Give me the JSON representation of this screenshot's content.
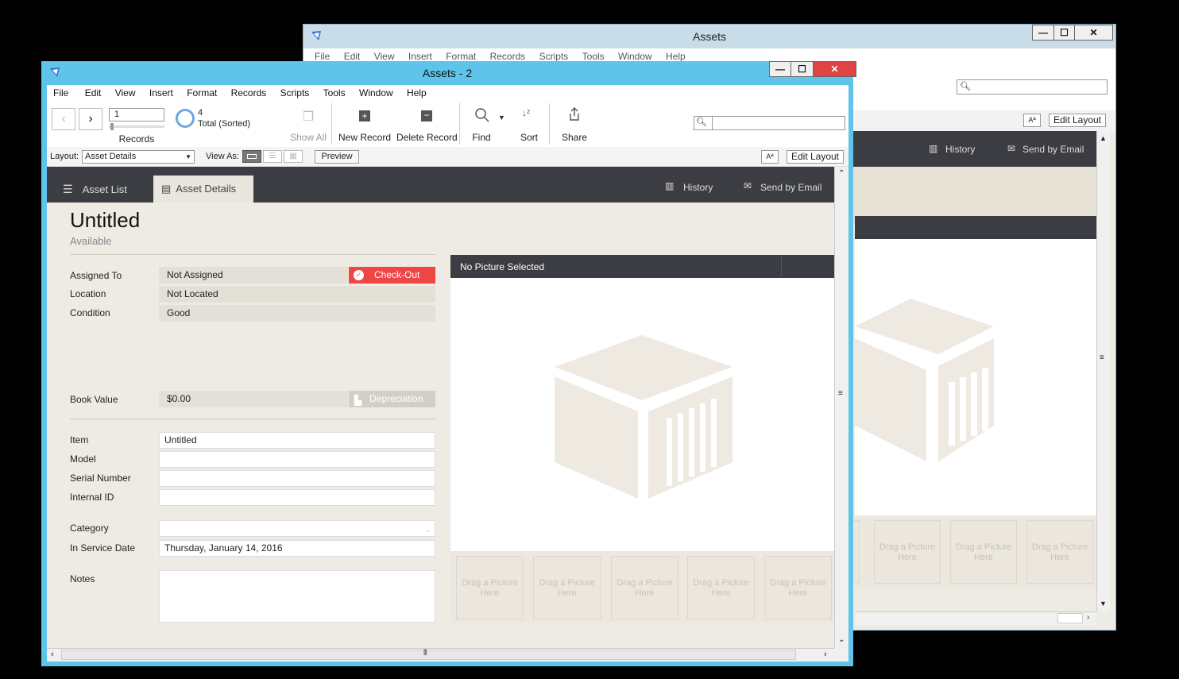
{
  "bg_window": {
    "title": "Assets",
    "menu": [
      "File",
      "Edit",
      "View",
      "Insert",
      "Format",
      "Records",
      "Scripts",
      "Tools",
      "Window",
      "Help"
    ],
    "history_label": "History",
    "send_email_label": "Send by Email",
    "edit_layout_label": "Edit Layout",
    "aa_label": "Aª",
    "thumb_label": "Drag a Picture Here",
    "window_buttons": {
      "minimize": "—",
      "maximize": "☐",
      "close": "✕"
    }
  },
  "window": {
    "title": "Assets - 2",
    "menu": [
      "File",
      "Edit",
      "View",
      "Insert",
      "Format",
      "Records",
      "Scripts",
      "Tools",
      "Window",
      "Help"
    ],
    "window_buttons": {
      "minimize": "—",
      "maximize": "☐",
      "close": "✕"
    }
  },
  "toolbar": {
    "record_number": "1",
    "records_label": "Records",
    "total_count": "4",
    "total_label": "Total (Sorted)",
    "show_all": "Show All",
    "new_record": "New Record",
    "delete_record": "Delete Record",
    "find": "Find",
    "sort": "Sort",
    "share": "Share"
  },
  "layoutbar": {
    "layout_label": "Layout:",
    "layout_value": "Asset Details",
    "view_as_label": "View As:",
    "preview": "Preview",
    "aa_label": "Aª",
    "edit_layout": "Edit Layout"
  },
  "nav": {
    "asset_list": "Asset List",
    "asset_details": "Asset Details",
    "history": "History",
    "send_email": "Send by Email"
  },
  "record": {
    "title": "Untitled",
    "status": "Available",
    "assigned_to_label": "Assigned To",
    "assigned_to": "Not Assigned",
    "checkout_label": "Check-Out",
    "location_label": "Location",
    "location": "Not Located",
    "condition_label": "Condition",
    "condition": "Good",
    "book_value_label": "Book Value",
    "book_value": "$0.00",
    "depreciation_label": "Depreciation",
    "item_label": "Item",
    "item": "Untitled",
    "model_label": "Model",
    "model": "",
    "serial_label": "Serial Number",
    "serial": "",
    "internal_id_label": "Internal ID",
    "internal_id": "",
    "category_label": "Category",
    "category": "",
    "in_service_label": "In Service Date",
    "in_service": "Thursday, January 14, 2016",
    "notes_label": "Notes",
    "notes": ""
  },
  "picture": {
    "header": "No Picture Selected",
    "thumb_label": "Drag a Picture Here"
  },
  "colors": {
    "title_bar": "#5ec4e9",
    "dark_bar": "#3b3d42",
    "content_bg": "#eeebe4",
    "checkout": "#f04545"
  }
}
